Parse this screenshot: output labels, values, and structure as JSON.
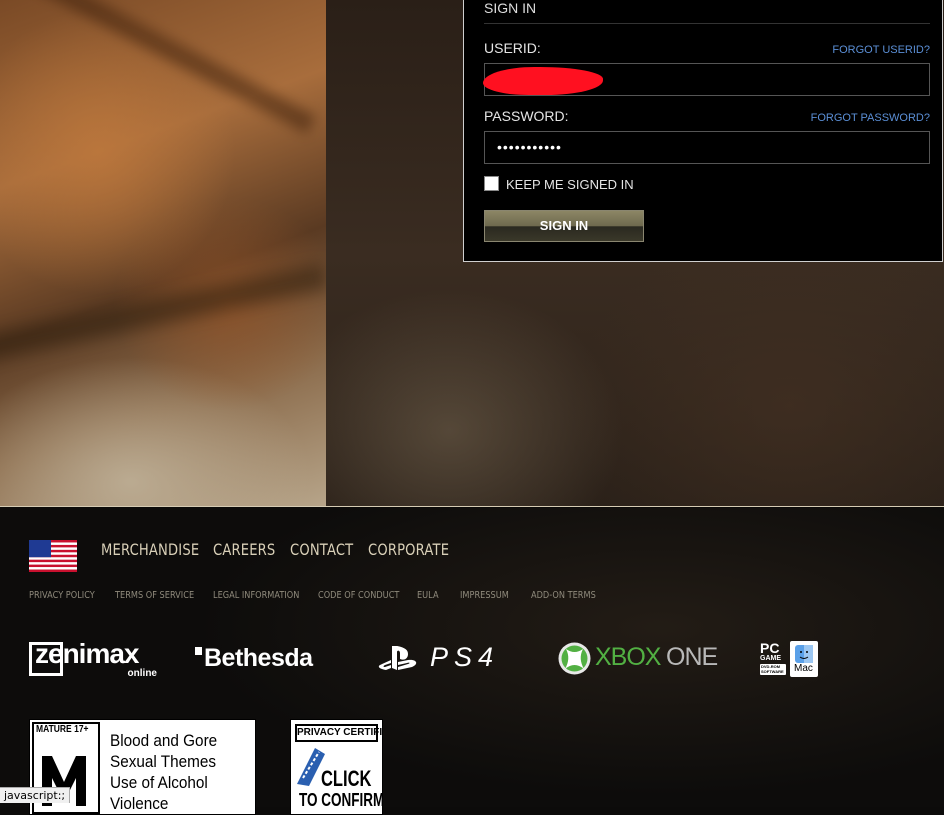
{
  "login": {
    "title": "SIGN IN",
    "userid_label": "USERID:",
    "forgot_userid": "FORGOT USERID?",
    "password_label": "PASSWORD:",
    "forgot_password": "FORGOT PASSWORD?",
    "password_value": "•••••••••••",
    "keep_signed_in": "KEEP ME SIGNED IN",
    "sign_in_button": "SIGN IN"
  },
  "footer": {
    "nav": [
      "MERCHANDISE",
      "CAREERS",
      "CONTACT",
      "CORPORATE"
    ],
    "sublinks": [
      "PRIVACY POLICY",
      "TERMS OF SERVICE",
      "LEGAL INFORMATION",
      "CODE OF CONDUCT",
      "EULA",
      "IMPRESSUM",
      "ADD-ON TERMS"
    ],
    "logos": {
      "zenimax": "zenimax",
      "zenimax_sub": "online",
      "bethesda": "Bethesda",
      "ps4": "PS4",
      "xbox_a": "XBOX",
      "xbox_b": "ONE",
      "pc_a": "PC",
      "pc_b": "GAME",
      "pc_c": "DVD-ROM",
      "pc_d": "SOFTWARE",
      "mac": "Mac"
    },
    "rating": {
      "label": "MATURE 17+",
      "descriptors": [
        "Blood and Gore",
        "Sexual Themes",
        "Use of Alcohol",
        "Violence"
      ]
    },
    "privacy": {
      "top": "PRIVACY CERTIFIED",
      "click": "CLICK",
      "confirm": "TO CONFIRM"
    }
  },
  "status_bar": "javascript:;",
  "colors": {
    "link_blue": "#5b8fd6",
    "nav_tan": "#d9d0b8",
    "xbox_green": "#52b043"
  }
}
